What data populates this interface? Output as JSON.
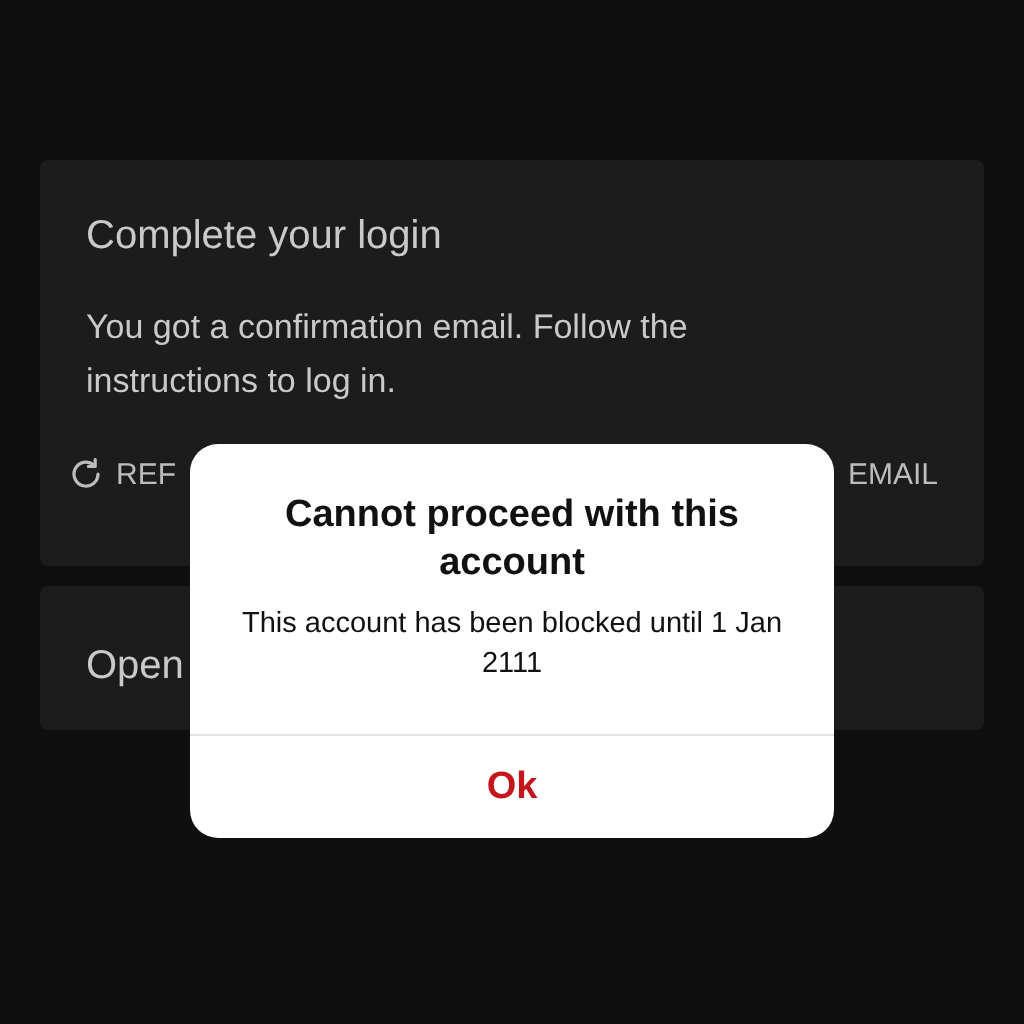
{
  "login_card": {
    "title": "Complete your login",
    "message": "You got a confirmation email. Follow the instructions to log in.",
    "actions": [
      {
        "kind": "refresh",
        "label": "REF"
      },
      {
        "kind": "email",
        "label": "EMAIL"
      }
    ]
  },
  "open_card": {
    "title": "Open"
  },
  "dialog": {
    "title": "Cannot proceed with this account",
    "message": "This account has been blocked until 1 Jan 2111",
    "button": "Ok"
  }
}
